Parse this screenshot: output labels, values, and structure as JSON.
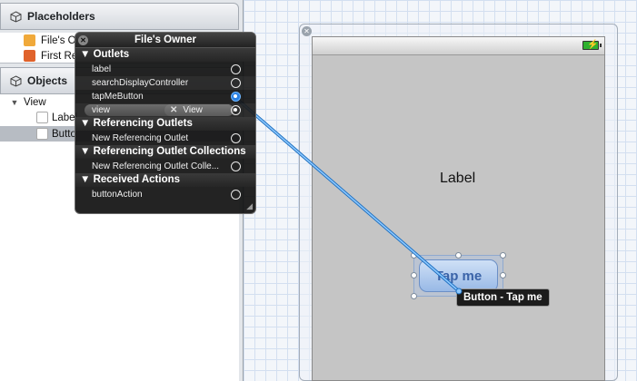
{
  "outline": {
    "placeholders_title": "Placeholders",
    "placeholders": [
      "File's O",
      "First Re"
    ],
    "objects_title": "Objects",
    "objects": [
      "View",
      "Label",
      "Butto"
    ]
  },
  "hud": {
    "title": "File's Owner",
    "sections": {
      "outlets": "Outlets",
      "referencing_outlets": "Referencing Outlets",
      "referencing_outlet_collections": "Referencing Outlet Collections",
      "received_actions": "Received Actions"
    },
    "outlets": [
      "label",
      "searchDisplayController",
      "tapMeButton"
    ],
    "view_outlet": {
      "name": "view",
      "target": "View"
    },
    "referencing_outlets": [
      "New Referencing Outlet"
    ],
    "referencing_outlet_collections": [
      "New Referencing Outlet Colle..."
    ],
    "received_actions": [
      "buttonAction"
    ]
  },
  "canvas": {
    "label_text": "Label",
    "button_title": "Tap me",
    "button_tooltip": "Button - Tap me"
  },
  "colors": {
    "connection_line": "#3a9be8",
    "button_fill": "#b4cdef",
    "battery": "#2fb12f"
  }
}
